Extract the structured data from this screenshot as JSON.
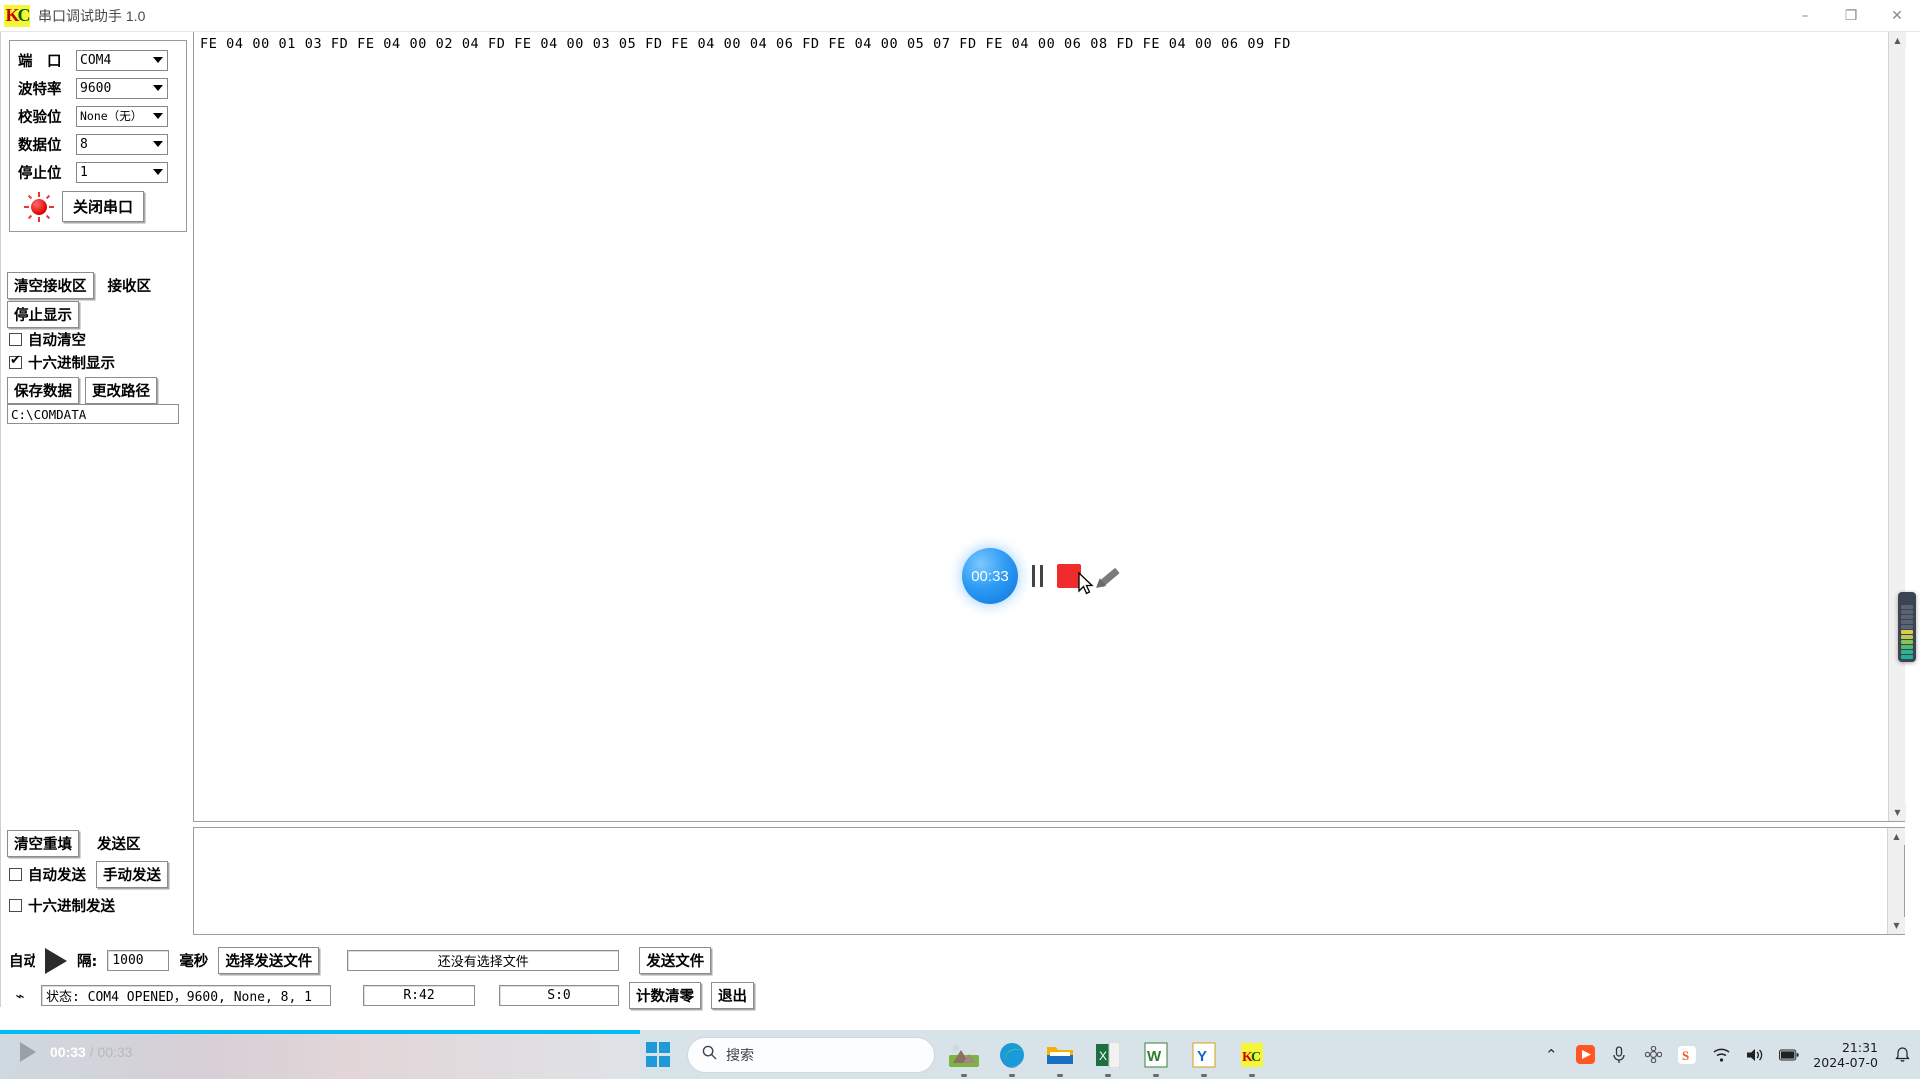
{
  "window": {
    "title": "串口调试助手 1.0",
    "logo_text": "KC",
    "minimize": "–",
    "maximize": "❐",
    "close": "✕"
  },
  "settings": {
    "fields": [
      {
        "label": "端　口",
        "value": "COM4",
        "name": "port"
      },
      {
        "label": "波特率",
        "value": "9600",
        "name": "baud-rate"
      },
      {
        "label": "校验位",
        "value": "None（无）",
        "name": "parity"
      },
      {
        "label": "数据位",
        "value": "8",
        "name": "data-bits"
      },
      {
        "label": "停止位",
        "value": "1",
        "name": "stop-bits"
      }
    ],
    "toggle_port_button": "关闭串口"
  },
  "receive": {
    "clear_button": "清空接收区",
    "title": "接收区",
    "stop_display_button": "停止显示",
    "auto_clear_label": "自动清空",
    "auto_clear_checked": false,
    "hex_display_label": "十六进制显示",
    "hex_display_checked": true,
    "save_data_button": "保存数据",
    "change_path_button": "更改路径",
    "save_path": "C:\\COMDATA",
    "data": "FE 04 00 01 03 FD FE 04 00 02 04 FD FE 04 00 03 05 FD FE 04 00 04 06 FD FE 04 00 05 07 FD FE 04 00 06 08 FD FE 04 00 06 09 FD"
  },
  "send": {
    "clear_refill_button": "清空重填",
    "title": "发送区",
    "auto_send_label": "自动发送",
    "auto_send_checked": false,
    "manual_send_button": "手动发送",
    "hex_send_label": "十六进制发送",
    "hex_send_checked": false,
    "content": ""
  },
  "toolbar": {
    "auto_label": "自动",
    "interval_label": "隔:",
    "interval_value": "1000",
    "unit_label": "毫秒",
    "choose_file_button": "选择发送文件",
    "chosen_file_text": "还没有选择文件",
    "send_file_button": "发送文件"
  },
  "status": {
    "connection": "状态: COM4 OPENED，9600, None, 8, 1",
    "received": "R:42",
    "sent": "S:0",
    "reset_count_button": "计数清零",
    "exit_button": "退出"
  },
  "recorder": {
    "elapsed": "00:33",
    "pause_name": "pause",
    "stop_name": "stop",
    "edit_name": "edit"
  },
  "player": {
    "current_time": "00:33",
    "separator": " / ",
    "total_time": "00:33"
  },
  "taskbar": {
    "search_placeholder": "搜索",
    "apps": [
      {
        "name": "wallpaper-app",
        "glyph": "🏞"
      },
      {
        "name": "edge-browser",
        "glyph": ""
      },
      {
        "name": "file-explorer",
        "glyph": ""
      },
      {
        "name": "excel",
        "glyph": "X"
      },
      {
        "name": "wps-writer",
        "glyph": "W"
      },
      {
        "name": "foxmail",
        "glyph": "Y"
      },
      {
        "name": "serial-tool",
        "glyph": "KC"
      }
    ],
    "tray": [
      {
        "name": "show-hidden-icons",
        "glyph": "⌃"
      },
      {
        "name": "recorder-tray",
        "glyph": "▶"
      },
      {
        "name": "microphone",
        "glyph": "🎤"
      },
      {
        "name": "input-method",
        "glyph": "✿"
      },
      {
        "name": "sogou-input",
        "glyph": "S"
      },
      {
        "name": "wifi",
        "glyph": "◗"
      },
      {
        "name": "volume",
        "glyph": "🔊"
      },
      {
        "name": "battery",
        "glyph": "▬"
      }
    ],
    "clock_time": "21:31",
    "clock_date": "2024-07-0",
    "notifications_icon": "🔔"
  },
  "colors": {
    "accent": "#00bcf2",
    "stop_red": "#ef2b2b",
    "timer_blue": "#2d9cf5"
  }
}
